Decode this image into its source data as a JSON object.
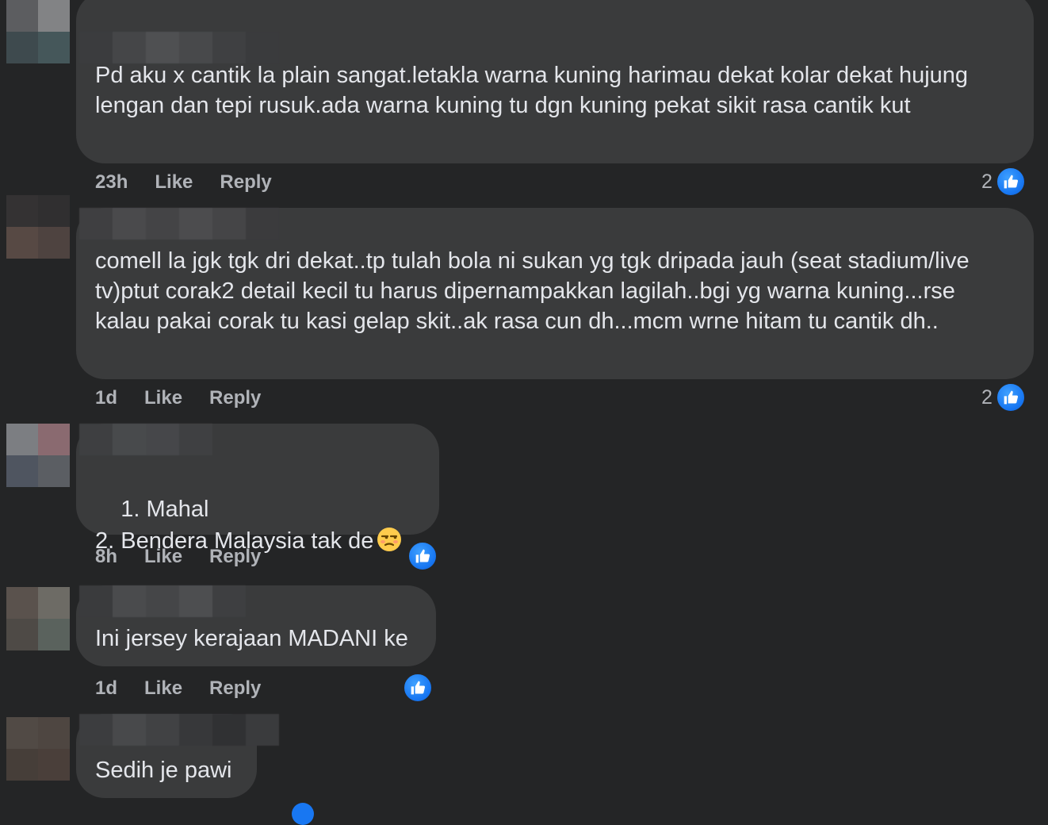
{
  "comments": [
    {
      "text": "Pd aku x cantik la plain sangat.letakla warna kuning harimau dekat kolar dekat hujung lengan dan tepi rusuk.ada warna kuning tu dgn kuning pekat sikit rasa cantik kut",
      "time": "23h",
      "like_label": "Like",
      "reply_label": "Reply",
      "reaction_count": "2",
      "avatar_colors": [
        "#5c5d60",
        "#828385",
        "#3e4a4e",
        "#45575a"
      ],
      "name_colors": [
        "#3b3c3e",
        "#454648",
        "#4f5052",
        "#48494b",
        "#3f4042",
        "#3a3b3d"
      ]
    },
    {
      "text": "comell la jgk tgk dri dekat..tp tulah bola ni sukan yg tgk dripada jauh (seat stadium/live tv)ptut corak2 detail kecil tu harus dipernampakkan lagilah..bgi yg warna kuning...rse kalau pakai corak tu kasi gelap skit..ak rasa cun dh...mcm wrne hitam tu cantik dh..",
      "time": "1d",
      "like_label": "Like",
      "reply_label": "Reply",
      "reaction_count": "2",
      "avatar_colors": [
        "#343233",
        "#302f30",
        "#574944",
        "#4e4340"
      ],
      "name_colors": [
        "#3f3f41",
        "#4a4a4c",
        "#444446",
        "#4c4c4e",
        "#454547",
        "#3b3b3d"
      ]
    },
    {
      "text": "1. Mahal\n2. Bendera Malaysia tak de",
      "emoji": "unamused-face",
      "time": "8h",
      "like_label": "Like",
      "reply_label": "Reply",
      "reaction_count": "",
      "avatar_colors": [
        "#7c7e82",
        "#8a6a70",
        "#4f5560",
        "#5b5e63"
      ],
      "name_colors": [
        "#3e3f41",
        "#484a4c",
        "#46474a",
        "#3f4042"
      ]
    },
    {
      "text": "Ini jersey kerajaan MADANI ke",
      "time": "1d",
      "like_label": "Like",
      "reply_label": "Reply",
      "reaction_count": "",
      "avatar_colors": [
        "#5a524d",
        "#6d6b65",
        "#4e4a46",
        "#5a625d"
      ],
      "name_colors": [
        "#3a3b3d",
        "#4a4b4d",
        "#454648",
        "#4d4e50",
        "#3e3f41"
      ]
    },
    {
      "text": "Sedih je pawi",
      "time": "",
      "like_label": "",
      "reply_label": "",
      "reaction_count": "",
      "avatar_colors": [
        "#514a45",
        "#4e4641",
        "#463e39",
        "#4a3f3a"
      ],
      "name_colors": [
        "#3c3d3f",
        "#48494b",
        "#414244",
        "#37383a",
        "#303133",
        "#3a3b3d"
      ]
    }
  ],
  "accent_color": "#1877f2",
  "icon": "thumbs-up-icon"
}
